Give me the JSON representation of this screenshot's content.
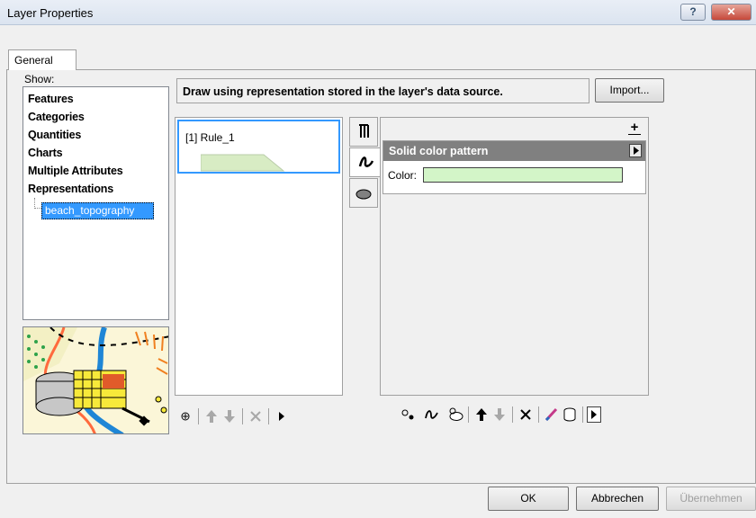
{
  "window": {
    "title": "Layer Properties",
    "help_label": "?",
    "close_label": "✕"
  },
  "tabs": {
    "general": "General"
  },
  "show": {
    "label": "Show:",
    "items": [
      "Features",
      "Categories",
      "Quantities",
      "Charts",
      "Multiple Attributes",
      "Representations"
    ],
    "selected_child": "beach_topography"
  },
  "description": "Draw using representation stored in the layer's data source.",
  "import_label": "Import...",
  "rules": {
    "items": [
      {
        "label": "[1] Rule_1",
        "fill_color": "#d8ecc4"
      }
    ]
  },
  "symbol": {
    "pattern_name": "Solid color pattern",
    "color_label": "Color:",
    "color_value": "#d3f5c8",
    "add_label": "+"
  },
  "icons": {
    "vertical_tabs": [
      "marker-symbol-icon",
      "line-symbol-icon",
      "fill-symbol-icon"
    ],
    "rule_toolbar": [
      "add-rule-icon",
      "move-up-icon",
      "move-down-icon",
      "delete-icon",
      "more-icon"
    ],
    "symbol_toolbar": [
      "add-marker-layer-icon",
      "add-stroke-layer-icon",
      "add-fill-layer-icon",
      "move-layer-up-icon",
      "move-layer-down-icon",
      "delete-layer-icon",
      "geometric-effect-icon",
      "cylinder-icon",
      "expand-icon"
    ]
  },
  "footer": {
    "ok": "OK",
    "cancel": "Abbrechen",
    "apply": "Übernehmen"
  }
}
